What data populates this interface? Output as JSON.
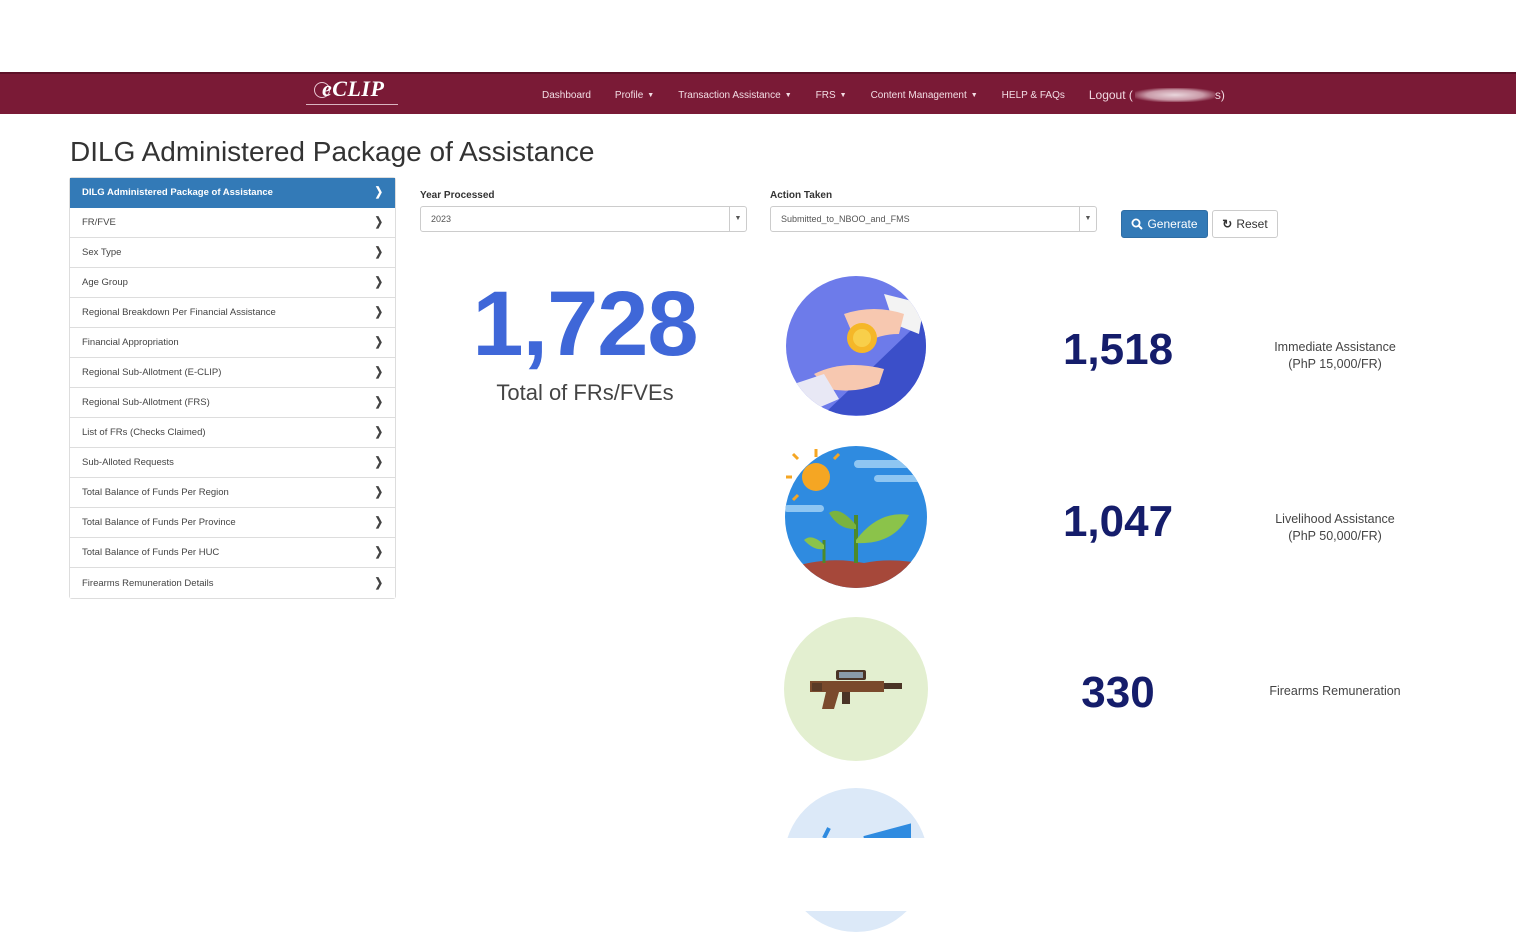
{
  "app": {
    "brand": "eCLIP",
    "nav": [
      {
        "label": "Dashboard",
        "caret": false
      },
      {
        "label": "Profile",
        "caret": true
      },
      {
        "label": "Transaction Assistance",
        "caret": true
      },
      {
        "label": "FRS",
        "caret": true
      },
      {
        "label": "Content Management",
        "caret": true
      },
      {
        "label": "HELP & FAQs",
        "caret": false
      }
    ],
    "logout_prefix": "Logout (",
    "logout_suffix": "s)"
  },
  "page": {
    "title": "DILG Administered Package of Assistance"
  },
  "sidebar": {
    "items": [
      {
        "label": "DILG Administered Package of Assistance",
        "active": true
      },
      {
        "label": "FR/FVE"
      },
      {
        "label": "Sex Type"
      },
      {
        "label": "Age Group"
      },
      {
        "label": "Regional Breakdown Per Financial Assistance"
      },
      {
        "label": "Financial Appropriation"
      },
      {
        "label": "Regional Sub-Allotment (E-CLIP)"
      },
      {
        "label": "Regional Sub-Allotment (FRS)"
      },
      {
        "label": "List of FRs (Checks Claimed)"
      },
      {
        "label": "Sub-Alloted Requests"
      },
      {
        "label": "Total Balance of Funds Per Region"
      },
      {
        "label": "Total Balance of Funds Per Province"
      },
      {
        "label": "Total Balance of Funds Per HUC"
      },
      {
        "label": "Firearms Remuneration Details"
      }
    ],
    "chevron_icon": "chevron-right-icon"
  },
  "filters": {
    "year": {
      "label": "Year Processed",
      "value": "2023"
    },
    "action": {
      "label": "Action Taken",
      "value": "Submitted_to_NBOO_and_FMS"
    },
    "generate_label": "Generate",
    "reset_label": "Reset"
  },
  "summary": {
    "total": "1,728",
    "total_label": "Total of FRs/FVEs"
  },
  "stats": [
    {
      "icon": "hand-coin-icon",
      "value": "1,518",
      "label_line1": "Immediate Assistance",
      "label_line2": "(PhP 15,000/FR)"
    },
    {
      "icon": "plant-growth-icon",
      "value": "1,047",
      "label_line1": "Livelihood Assistance",
      "label_line2": "(PhP 50,000/FR)"
    },
    {
      "icon": "rifle-icon",
      "value": "330",
      "label_line1": "Firearms Remuneration",
      "label_line2": ""
    }
  ],
  "colors": {
    "navbar": "#7a1a36",
    "primary": "#337ab7",
    "total_number": "#3f67d8",
    "stat_number": "#151d6b"
  }
}
